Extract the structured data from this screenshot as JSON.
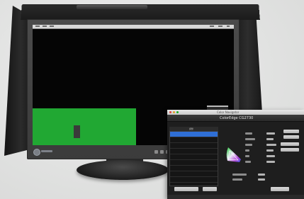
{
  "scene": {
    "background_color": "#e0e1e0",
    "monitor_color": "#3f3f3f",
    "screen_color": "#050505",
    "green_color": "#21a833"
  },
  "app_window": {
    "title": "Color Navigator",
    "heading": "ColorEdge CG2730",
    "list_header": "調整",
    "list_items": [
      {
        "label": "",
        "selected": true
      },
      {
        "label": "",
        "selected": false
      },
      {
        "label": "",
        "selected": false
      },
      {
        "label": "",
        "selected": false
      },
      {
        "label": "",
        "selected": false
      },
      {
        "label": "",
        "selected": false
      },
      {
        "label": "",
        "selected": false
      },
      {
        "label": "",
        "selected": false
      },
      {
        "label": "",
        "selected": false
      }
    ],
    "accent_color": "#2f6fd6"
  }
}
